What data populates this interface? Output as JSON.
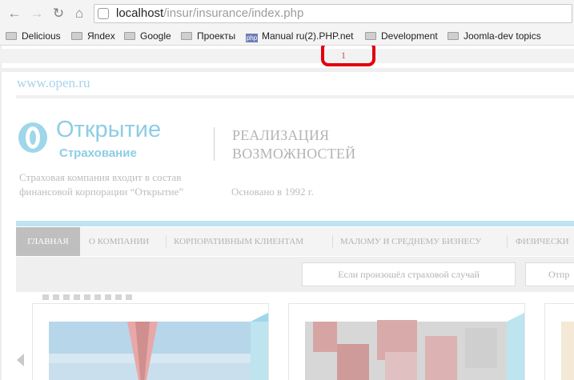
{
  "browser": {
    "url_host": "localhost",
    "url_path": "/insur/insurance/index.php",
    "bookmarks": [
      {
        "label": "Delicious",
        "icon": "folder-icon"
      },
      {
        "label": "Яndex",
        "icon": "folder-icon"
      },
      {
        "label": "Google",
        "icon": "folder-icon"
      },
      {
        "label": "Проекты",
        "icon": "folder-icon"
      },
      {
        "label": "Manual ru(2).PHP.net",
        "icon": "php-icon"
      },
      {
        "label": "Development",
        "icon": "folder-icon"
      },
      {
        "label": "Joomla-dev topics",
        "icon": "folder-icon"
      }
    ],
    "php_icon_text": "php"
  },
  "page": {
    "page_number": "1",
    "site_link": {
      "prefix": "www.",
      "highlight": "open",
      "suffix": ".ru"
    },
    "logo": {
      "name": "Открытие",
      "sub": "Страхование"
    },
    "slogan": [
      "РЕАЛИЗАЦИЯ",
      "ВОЗМОЖНОСТЕЙ"
    ],
    "company_desc": [
      "Страховая компания входит в состав",
      "финансовой корпорации “Открытие”"
    ],
    "founded": "Основано в 1992 г.",
    "menu": [
      {
        "label": "ГЛАВНАЯ",
        "active": true
      },
      {
        "label": "О КОМПАНИИ",
        "active": false
      },
      {
        "label": "КОРПОРАТИВНЫМ КЛИЕНТАМ",
        "active": false
      },
      {
        "label": "МАЛОМУ И СРЕДНЕМУ БИЗНЕСУ",
        "active": false
      },
      {
        "label": "ФИЗИЧЕСКИ",
        "active": false
      }
    ],
    "sub_buttons": [
      "Если произошёл страховой случай",
      "Отпр"
    ],
    "colors": {
      "brand": "#8ecde5",
      "highlight_box": "#e1000f",
      "accent_bar": "#bde4ef"
    }
  }
}
